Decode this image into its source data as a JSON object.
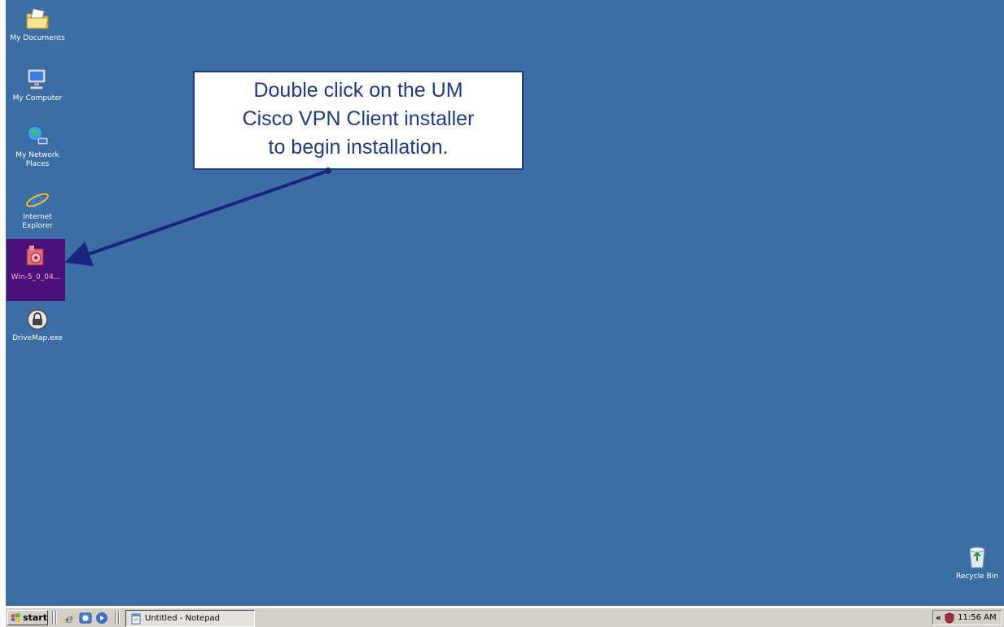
{
  "desktop": {
    "background": "#3a6ea5",
    "icons": [
      {
        "label": "My Documents",
        "icon": "folder-documents-icon"
      },
      {
        "label": "My Computer",
        "icon": "computer-icon"
      },
      {
        "label": "My Network Places",
        "icon": "network-places-icon"
      },
      {
        "label": "Internet Explorer",
        "icon": "internet-explorer-icon"
      },
      {
        "label": "Win-5_0_04...",
        "icon": "installer-package-icon",
        "selected": true
      },
      {
        "label": "DriveMap.exe",
        "icon": "lock-icon"
      }
    ],
    "recycle_bin": {
      "label": "Recycle Bin",
      "icon": "recycle-bin-icon"
    }
  },
  "callout": {
    "text": "Double click on the UM Cisco VPN Client installer to begin installation.",
    "line1": "Double click on the UM",
    "line2": "Cisco VPN Client installer",
    "line3": "to begin installation.",
    "border_color": "#1f3a8a",
    "arrow_color": "#1a237e"
  },
  "taskbar": {
    "start_label": "start",
    "quick_launch": [
      "internet-explorer-icon",
      "outlook-express-icon",
      "media-player-icon"
    ],
    "tasks": [
      {
        "label": "Untitled - Notepad",
        "icon": "notepad-icon"
      }
    ],
    "tray": {
      "expand": "«",
      "clock": "11:56 AM",
      "icons": [
        "security-shield-icon"
      ]
    }
  }
}
